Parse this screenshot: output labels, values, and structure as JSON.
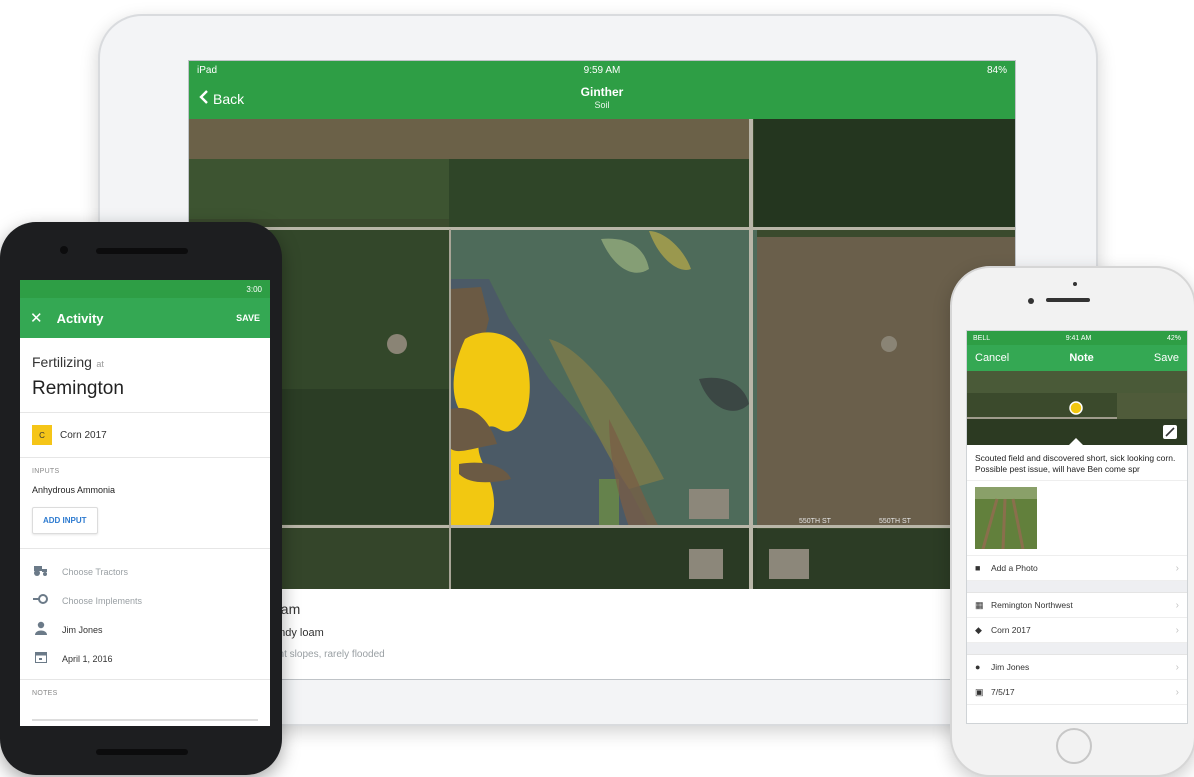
{
  "ipad": {
    "status": {
      "carrier": "iPad",
      "time": "9:59 AM",
      "battery": "84%"
    },
    "nav": {
      "back_label": "Back",
      "title": "Ginther",
      "subtitle": "Soil"
    },
    "map_labels": {
      "road_1": "550TH ST",
      "road_2": "550TH ST"
    },
    "soil": {
      "name": "oam",
      "type": "andy loam",
      "description": "ent slopes, rarely flooded"
    }
  },
  "android": {
    "status_time": "3:00",
    "appbar": {
      "title": "Activity",
      "save_label": "SAVE"
    },
    "activity": {
      "action": "Fertilizing",
      "at": "at",
      "place": "Remington"
    },
    "crop": {
      "badge": "C",
      "label": "Corn 2017"
    },
    "inputs": {
      "section_label": "INPUTS",
      "item": "Anhydrous Ammonia",
      "add_label": "ADD INPUT"
    },
    "rows": {
      "tractors": "Choose Tractors",
      "implements": "Choose Implements",
      "operator": "Jim Jones",
      "date": "April 1, 2016"
    },
    "notes_label": "NOTES"
  },
  "iphone": {
    "status": {
      "carrier": "BELL",
      "time": "9:41 AM",
      "battery": "42%"
    },
    "nav": {
      "cancel_label": "Cancel",
      "title": "Note",
      "save_label": "Save"
    },
    "note_text": "Scouted field and discovered short, sick looking corn. Possible pest issue, will have Ben come spr",
    "rows": {
      "add_photo": "Add a Photo",
      "field": "Remington Northwest",
      "crop": "Corn 2017",
      "person": "Jim Jones",
      "date": "7/5/17"
    }
  },
  "colors": {
    "brand_green": "#2e9e45",
    "crop_yellow": "#f5c518",
    "soil_yellow": "#f2c811"
  },
  "icons": [
    "chevron-left-icon",
    "close-icon",
    "tractor-icon",
    "implement-icon",
    "person-icon",
    "calendar-icon",
    "camera-icon",
    "field-icon",
    "leaf-icon",
    "chevron-right-icon",
    "edit-icon"
  ]
}
